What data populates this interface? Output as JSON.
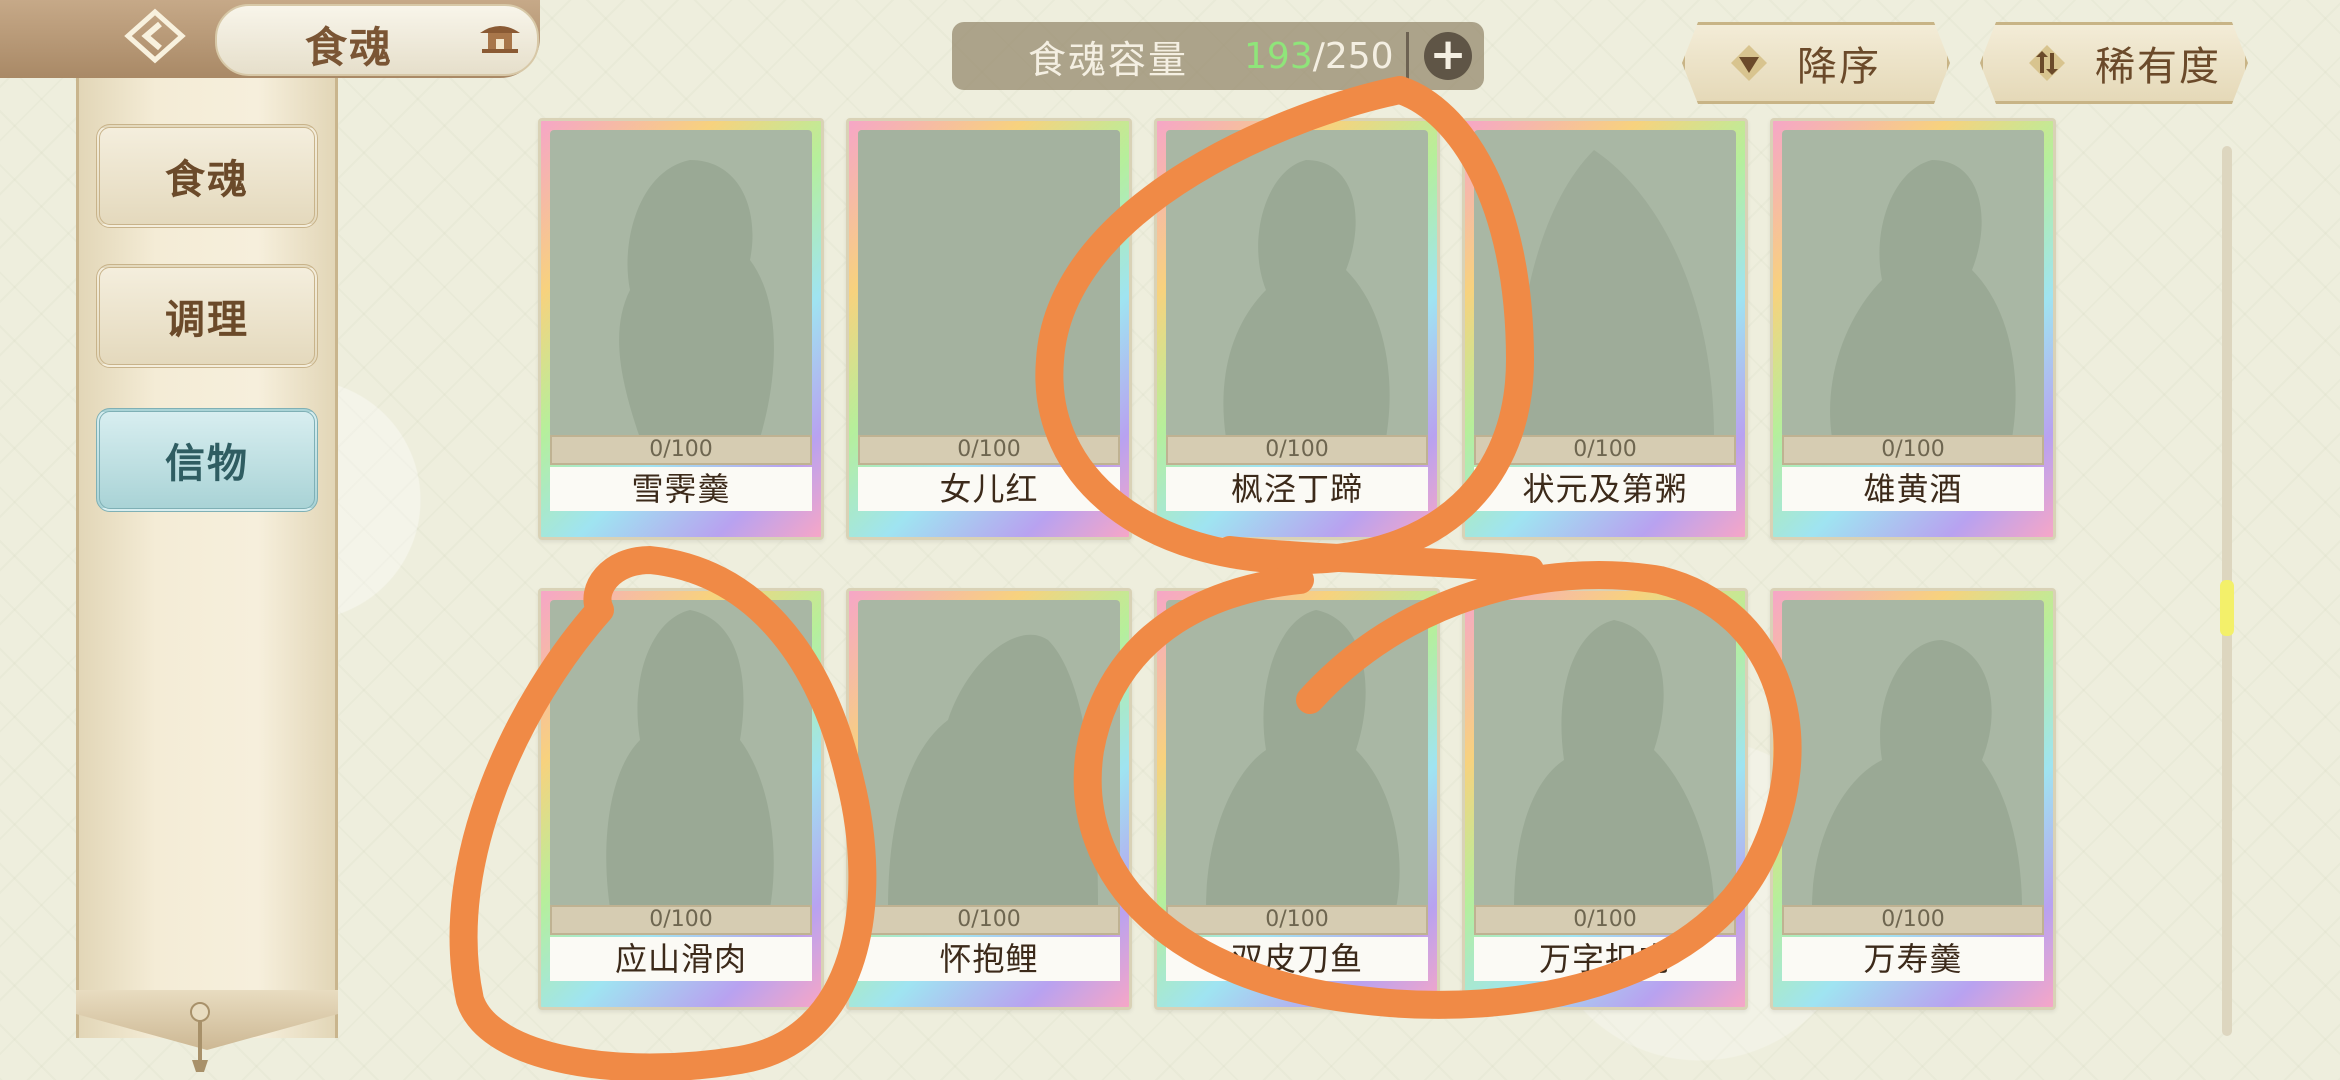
{
  "header": {
    "title": "食魂",
    "back_icon": "chevron-left-diamond-icon",
    "home_icon": "pavilion-icon"
  },
  "capacity": {
    "label": "食魂容量",
    "current": "193",
    "max": "/250",
    "add_icon": "plus-icon",
    "current_color": "#8fe57a"
  },
  "sort": {
    "order_label": "降序",
    "order_icon": "triangle-down-icon",
    "rarity_label": "稀有度",
    "rarity_icon": "sort-arrows-icon"
  },
  "sidebar": {
    "items": [
      {
        "label": "食魂",
        "active": false
      },
      {
        "label": "调理",
        "active": false
      },
      {
        "label": "信物",
        "active": true
      }
    ],
    "active_color": "#a9d3d6"
  },
  "cards": [
    {
      "name": "雪霁羹",
      "progress": "0/100"
    },
    {
      "name": "女儿红",
      "progress": "0/100"
    },
    {
      "name": "枫泾丁蹄",
      "progress": "0/100"
    },
    {
      "name": "状元及第粥",
      "progress": "0/100"
    },
    {
      "name": "雄黄酒",
      "progress": "0/100"
    },
    {
      "name": "应山滑肉",
      "progress": "0/100"
    },
    {
      "name": "怀抱鲤",
      "progress": "0/100"
    },
    {
      "name": "双皮刀鱼",
      "progress": "0/100"
    },
    {
      "name": "万字扣肉",
      "progress": "0/100"
    },
    {
      "name": "万寿羹",
      "progress": "0/100"
    }
  ],
  "annotation_color": "#f08a46"
}
